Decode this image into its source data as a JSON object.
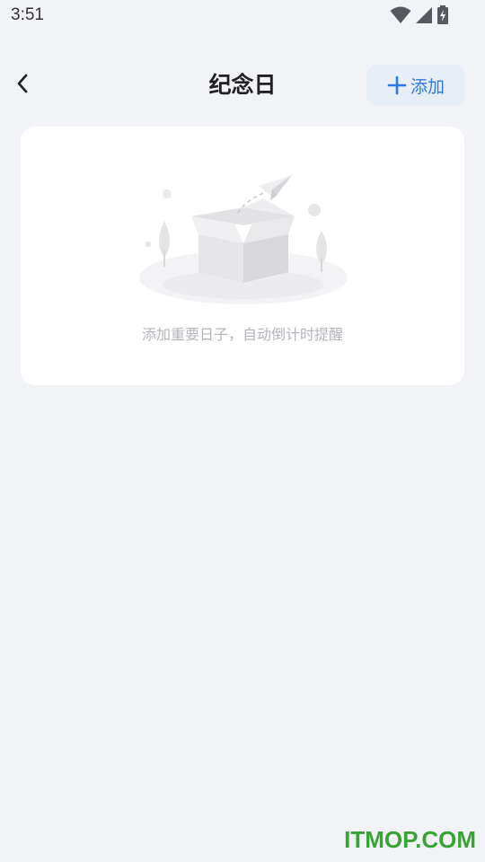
{
  "status_bar": {
    "time": "3:51",
    "icons": [
      "wifi-icon",
      "cellular-signal-icon",
      "battery-charging-icon"
    ]
  },
  "header": {
    "title": "纪念日",
    "back_icon": "chevron-left-icon",
    "add_button": {
      "icon": "plus-icon",
      "label": "添加"
    }
  },
  "empty_state": {
    "illustration": "empty-box-with-paper-plane",
    "message": "添加重要日子，自动倒计时提醒"
  },
  "watermark": {
    "text": "ITMOP.COM"
  },
  "colors": {
    "background": "#f2f3f7",
    "card": "#ffffff",
    "accent": "#2c78e6",
    "accent_bg": "#e8eef8",
    "title": "#1f1f24",
    "muted_text": "#b3b5bb",
    "watermark": "#3aa335"
  }
}
